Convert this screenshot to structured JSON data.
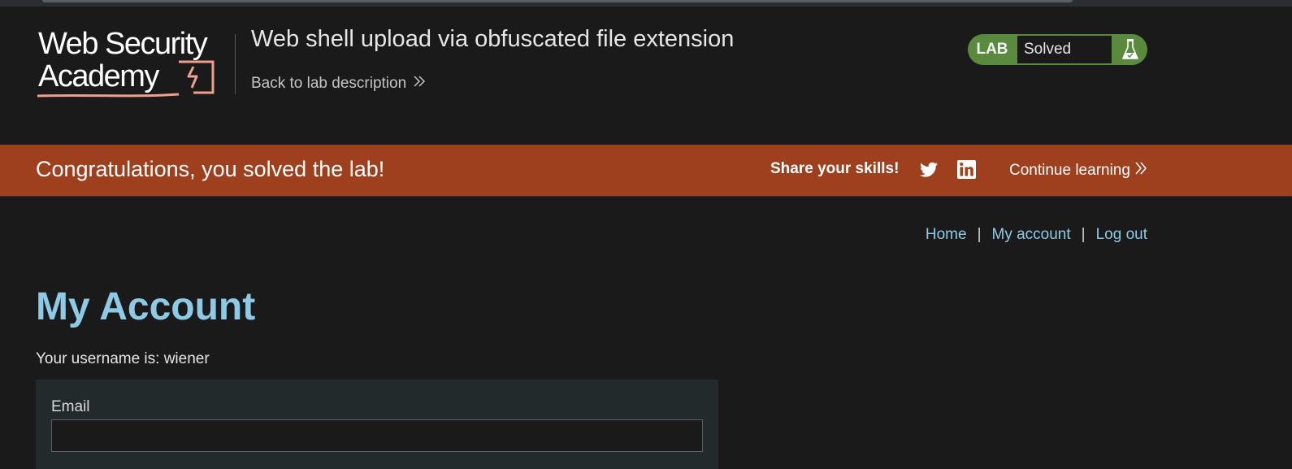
{
  "header": {
    "logo_text": [
      "Web Security",
      "Academy"
    ],
    "lab_title": "Web shell upload via obfuscated file extension",
    "back_link": "Back to lab description",
    "lab_badge": "LAB",
    "lab_status": "Solved",
    "icons": {
      "back": "double-chevron-right-icon",
      "status": "flask-icon"
    }
  },
  "banner": {
    "message": "Congratulations, you solved the lab!",
    "share_label": "Share your skills!",
    "continue_label": "Continue learning",
    "icons": [
      "twitter-icon",
      "linkedin-icon",
      "double-chevron-right-icon"
    ],
    "color": "#9e3f1d"
  },
  "nav": {
    "items": [
      "Home",
      "My account",
      "Log out"
    ],
    "separator": "|"
  },
  "main": {
    "title": "My Account",
    "username_line": "Your username is: wiener",
    "form": {
      "email_label": "Email",
      "email_value": ""
    }
  },
  "colors": {
    "background": "#1a1a1a",
    "accent_link": "#8ecae6",
    "lab_solved": "#5a8a3e",
    "logo_red": "#ee9f8b"
  }
}
